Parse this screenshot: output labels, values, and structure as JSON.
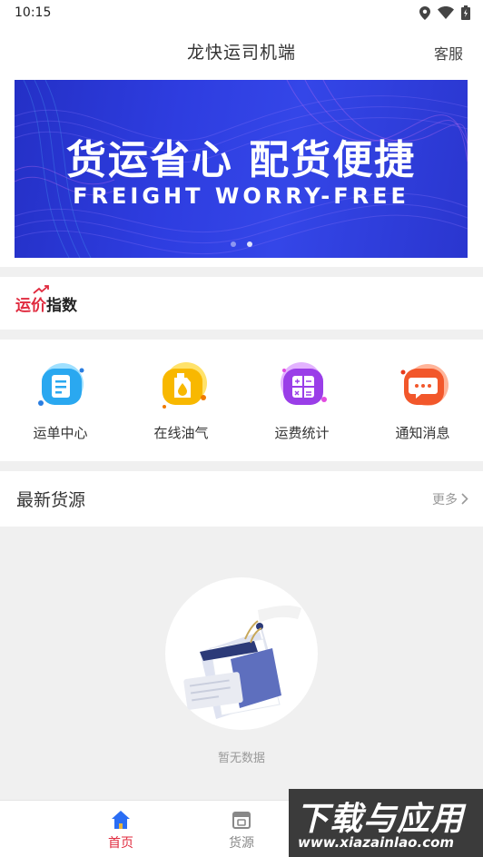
{
  "status_bar": {
    "time": "10:15"
  },
  "header": {
    "title": "龙快运司机端",
    "service_label": "客服"
  },
  "banner": {
    "title": "货运省心 配货便捷",
    "subtitle": "FREIGHT WORRY-FREE",
    "slide_count": 2,
    "active_slide": 2
  },
  "price_index": {
    "label_red": "运价",
    "label_black": "指数"
  },
  "quick_menu": [
    {
      "label": "运单中心",
      "icon": "waybill-icon",
      "color": "#2aa8f0"
    },
    {
      "label": "在线油气",
      "icon": "fuel-icon",
      "color": "#f8b800"
    },
    {
      "label": "运费统计",
      "icon": "calculator-icon",
      "color": "#9a3ee8"
    },
    {
      "label": "通知消息",
      "icon": "message-icon",
      "color": "#f2572b"
    }
  ],
  "latest_goods": {
    "title": "最新货源",
    "more_label": "更多"
  },
  "empty_state": {
    "text": "暂无数据"
  },
  "bottom_nav": [
    {
      "label": "首页",
      "icon": "home-icon",
      "active": true
    },
    {
      "label": "货源",
      "icon": "cargo-icon",
      "active": false
    }
  ],
  "watermark": {
    "big": "下载与应用",
    "small": "www.xiazainlao.com"
  },
  "colors": {
    "accent_red": "#e02a3e",
    "banner_blue": "#2e3de0",
    "nav_active": "#2a6df4"
  }
}
